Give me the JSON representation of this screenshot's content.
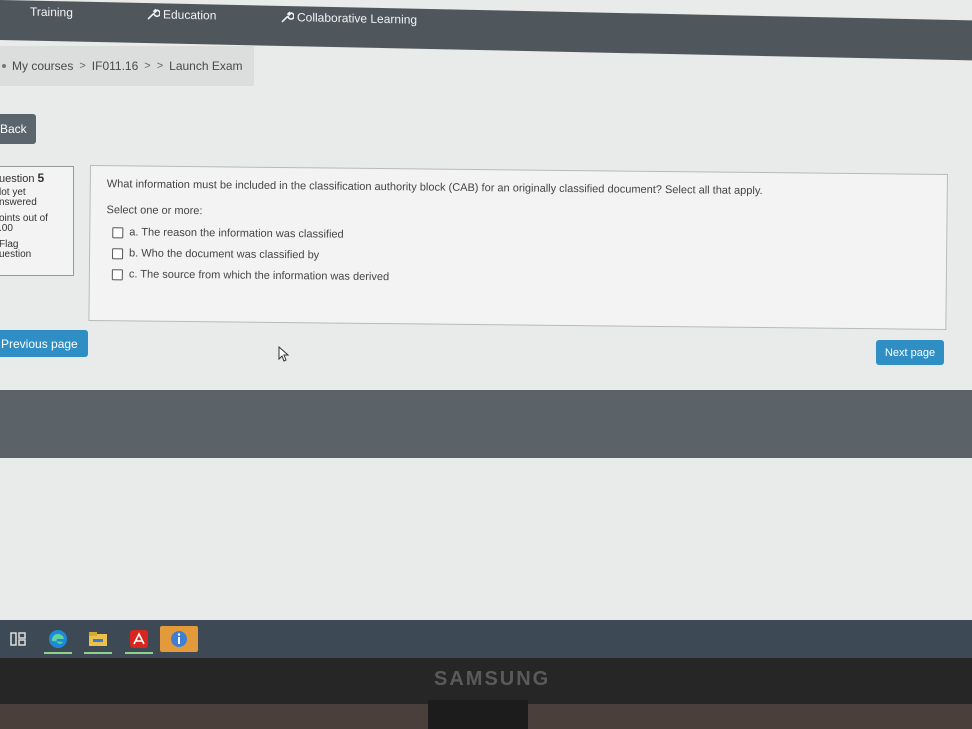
{
  "nav": {
    "training": "Training",
    "education": "Education",
    "collab": "Collaborative Learning"
  },
  "breadcrumb": {
    "my_courses": "My courses",
    "course": "IF011.16",
    "sep": ">",
    "launch": "Launch Exam"
  },
  "back_label": "Back",
  "question_info": {
    "label": "uestion",
    "number": "5",
    "status_line1": "lot yet",
    "status_line2": "nswered",
    "points_line1": "oints out of",
    "points_line2": ".00",
    "flag_line1": "Flag",
    "flag_line2": "uestion"
  },
  "question": {
    "text": "What information must be included in the classification authority block (CAB) for an originally classified document? Select all that apply.",
    "select_label": "Select one or more:",
    "options": [
      {
        "label": "a. The reason the information was classified"
      },
      {
        "label": "b. Who the document was classified by"
      },
      {
        "label": "c. The source from which the information was derived"
      }
    ]
  },
  "prev_label": "Previous page",
  "next_label": "Next page",
  "monitor_brand": "SAMSUNG",
  "colors": {
    "accent": "#2f8ec4",
    "nav_bg": "#4f575d",
    "taskbar": "#3d4a55"
  }
}
